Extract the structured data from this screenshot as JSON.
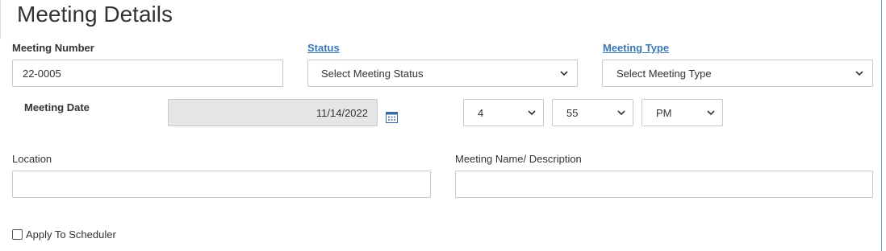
{
  "section": {
    "title": "Meeting Details"
  },
  "meeting_number": {
    "label": "Meeting Number",
    "value": "22-0005"
  },
  "status": {
    "label": "Status",
    "selected": "Select Meeting Status"
  },
  "meeting_type": {
    "label": "Meeting Type",
    "selected": "Select Meeting Type"
  },
  "meeting_date": {
    "label": "Meeting Date",
    "value": "11/14/2022",
    "hour": "4",
    "minute": "55",
    "ampm": "PM"
  },
  "location": {
    "label": "Location",
    "value": ""
  },
  "meeting_name": {
    "label": "Meeting Name/ Description",
    "value": ""
  },
  "scheduler": {
    "label": "Apply To Scheduler",
    "checked": false
  },
  "colors": {
    "link": "#3a78b5",
    "border_accent": "#5a9ed6",
    "disabled_bg": "#e6e6e6"
  },
  "icons": {
    "calendar": "calendar-icon",
    "dropdown": "chevron-down-icon"
  }
}
